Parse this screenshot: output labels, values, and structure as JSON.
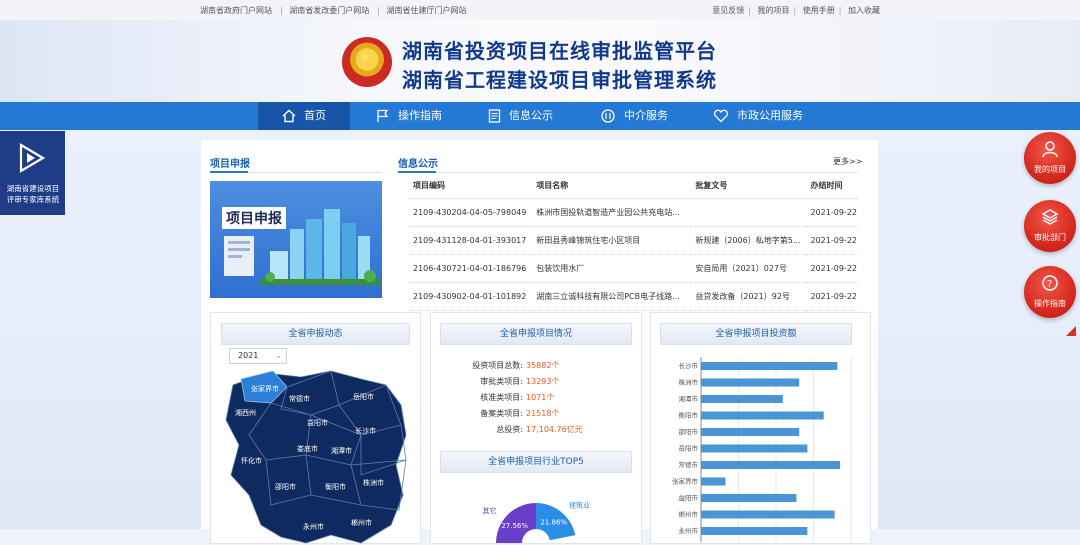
{
  "topbar": {
    "left_links": [
      "湖南省政府门户网站",
      "湖南省发改委门户网站",
      "湖南省住建厅门户网站"
    ],
    "right_links": [
      "意见反馈",
      "我的项目",
      "使用手册",
      "加入收藏"
    ]
  },
  "header": {
    "title_line1": "湖南省投资项目在线审批监管平台",
    "title_line2": "湖南省工程建设项目审批管理系统"
  },
  "nav": {
    "items": [
      {
        "label": "首页",
        "icon": "home-icon"
      },
      {
        "label": "操作指南",
        "icon": "flag-icon"
      },
      {
        "label": "信息公示",
        "icon": "document-icon"
      },
      {
        "label": "中介服务",
        "icon": "handshake-icon"
      },
      {
        "label": "市政公用服务",
        "icon": "heart-icon"
      }
    ]
  },
  "left_tile": {
    "label": "湖南省建设项目评审专家库系统",
    "icon": "play-logo-icon"
  },
  "project": {
    "section_title": "项目申报",
    "banner_label": "项目申报"
  },
  "info": {
    "section_title": "信息公示",
    "more_label": "更多>>",
    "columns": [
      "项目编码",
      "项目名称",
      "批复文号",
      "办结时间"
    ],
    "rows": [
      [
        "2109-430204-04-05-798049",
        "株洲市国投轨道智造产业园公共充电站...",
        "",
        "2021-09-22"
      ],
      [
        "2109-431128-04-01-393017",
        "新田县秀峰锦筑住宅小区项目",
        "新规建（2006）私地字第5...",
        "2021-09-22"
      ],
      [
        "2106-430721-04-01-186796",
        "包装饮用水厂",
        "安自局用（2021）027号",
        "2021-09-22"
      ],
      [
        "2109-430902-04-01-101892",
        "湖南三立诚科技有限公司PCB电子线路...",
        "益贷发改备（2021）92号",
        "2021-09-22"
      ]
    ]
  },
  "dynamics": {
    "title": "全省申报动态",
    "year": "2021",
    "chevron": "chevron-down-icon"
  },
  "summary": {
    "title": "全省申报项目情况",
    "stats": [
      {
        "label": "投资项目总数:",
        "value": "35882个"
      },
      {
        "label": "审批类项目:",
        "value": "13293个"
      },
      {
        "label": "核准类项目:",
        "value": "1071个"
      },
      {
        "label": "备案类项目:",
        "value": "21518个"
      },
      {
        "label": "总投资:",
        "value": "17,104.76亿元"
      }
    ],
    "top5_title": "全省申报项目行业TOP5"
  },
  "investment": {
    "title": "全省申报项目投资额"
  },
  "map": {
    "highlight_color": "#2a7fd8",
    "base_color": "#0f2a5e",
    "regions": [
      "张家界市",
      "常德市",
      "岳阳市",
      "湘西州",
      "益阳市",
      "长沙市",
      "娄底市",
      "湘潭市",
      "怀化市",
      "邵阳市",
      "衡阳市",
      "株洲市",
      "永州市",
      "郴州市"
    ]
  },
  "chart_data": [
    {
      "type": "bar",
      "orientation": "horizontal",
      "title": "全省申报项目投资额",
      "categories": [
        "长沙市",
        "株洲市",
        "湘潭市",
        "衡阳市",
        "邵阳市",
        "岳阳市",
        "常德市",
        "张家界市",
        "益阳市",
        "郴州市",
        "永州市"
      ],
      "values": [
        100,
        72,
        60,
        90,
        72,
        78,
        102,
        18,
        70,
        98,
        78
      ],
      "color": "#4a95d6",
      "grid": true
    },
    {
      "type": "pie",
      "title": "全省申报项目行业TOP5",
      "slices": [
        {
          "label": "建筑业",
          "percent": 21.86,
          "color": "#2a8ee6"
        },
        {
          "label": "其它",
          "percent": 27.56,
          "color": "#6b3ec9"
        }
      ]
    }
  ],
  "float_buttons": [
    {
      "label": "我的项目",
      "icon": "user-icon"
    },
    {
      "label": "审批部门",
      "icon": "layers-icon"
    },
    {
      "label": "操作指南",
      "icon": "question-icon"
    }
  ]
}
